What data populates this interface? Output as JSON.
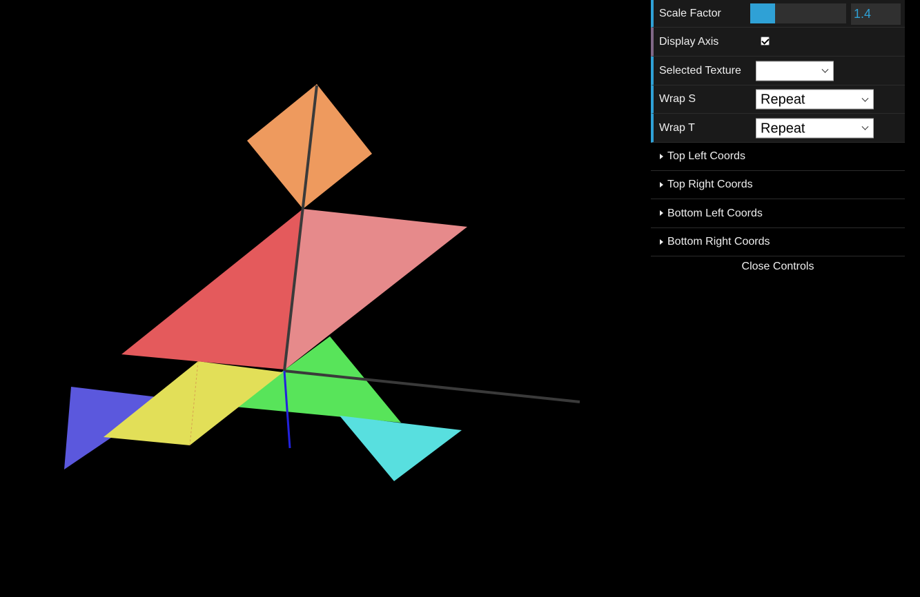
{
  "gui": {
    "scale_factor": {
      "label": "Scale Factor",
      "value": "1.4",
      "fill_fraction": 0.26
    },
    "display_axis": {
      "label": "Display Axis",
      "checked": true
    },
    "selected_texture": {
      "label": "Selected Texture",
      "value": ""
    },
    "wrap_s": {
      "label": "Wrap S",
      "value": "Repeat"
    },
    "wrap_t": {
      "label": "Wrap T",
      "value": "Repeat"
    },
    "folders": [
      {
        "label": "Top Left Coords"
      },
      {
        "label": "Top Right Coords"
      },
      {
        "label": "Bottom Left Coords"
      },
      {
        "label": "Bottom Right Coords"
      }
    ],
    "close_label": "Close Controls"
  },
  "scene": {
    "colors": {
      "orange": "#ee9a5e",
      "red": "#e45a5c",
      "pink": "#e68a8b",
      "yellow": "#e2df58",
      "blue": "#5b58dd",
      "green": "#58e45a",
      "cyan": "#58dfdf",
      "axis_gray": "#3a3a3a",
      "axis_blue": "#2222dd"
    }
  }
}
